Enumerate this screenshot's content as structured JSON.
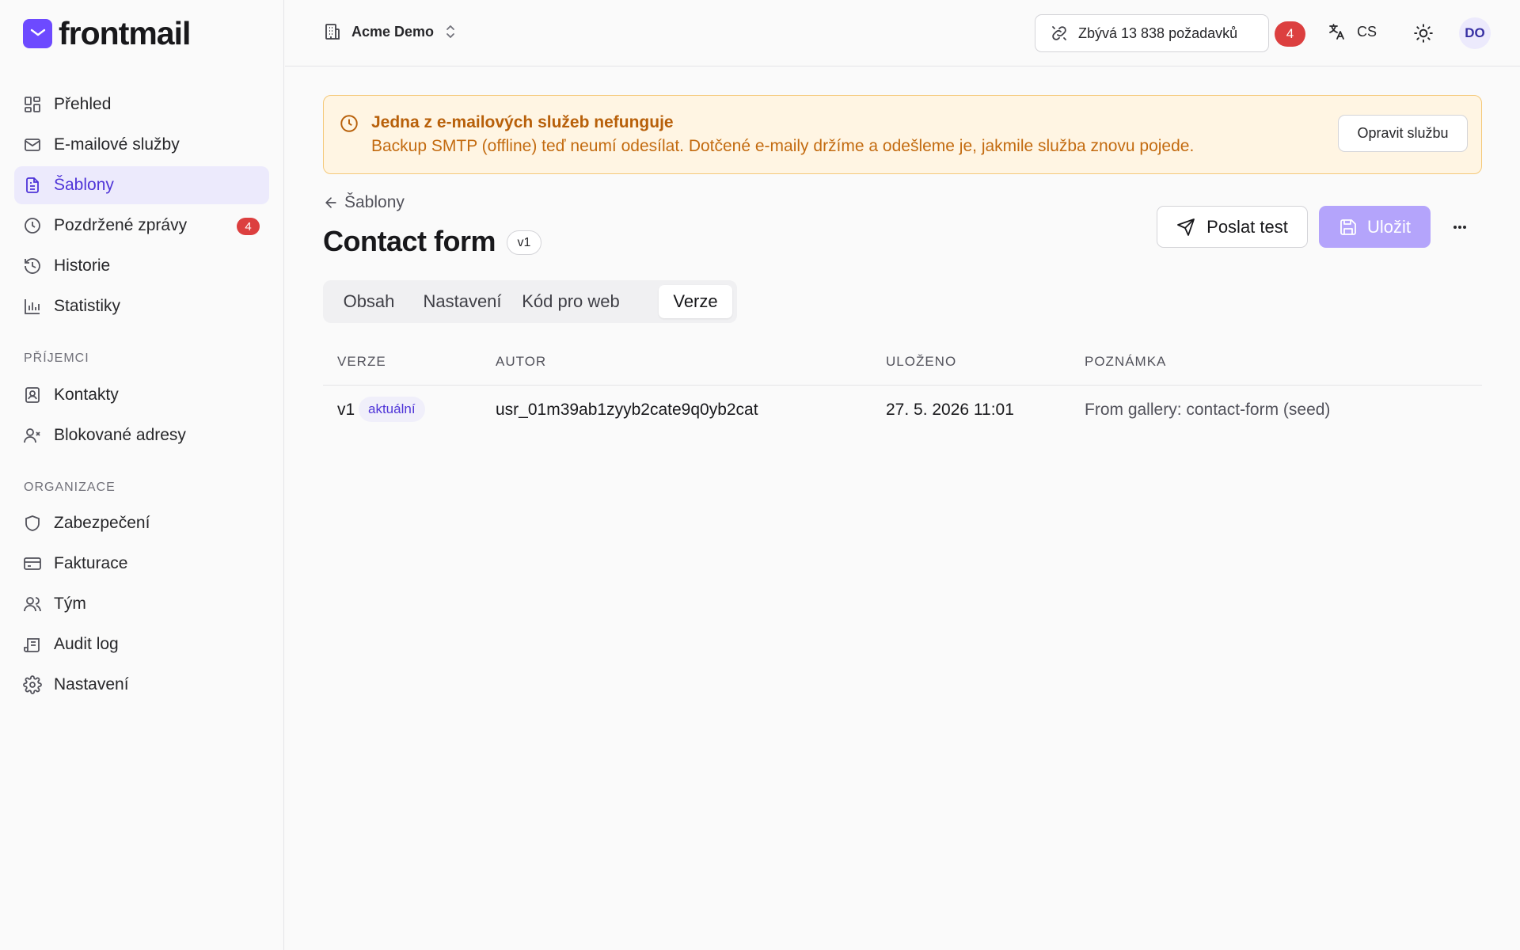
{
  "app": {
    "brand": "frontmail",
    "accent_color": "#6d4aff"
  },
  "sidebar": {
    "main_items": [
      {
        "label": "Přehled",
        "icon": "dashboard-icon"
      },
      {
        "label": "E-mailové služby",
        "icon": "mail-icon"
      },
      {
        "label": "Šablony",
        "icon": "file-text-icon",
        "active": true
      },
      {
        "label": "Pozdržené zprávy",
        "icon": "clock-icon",
        "badge": "4"
      },
      {
        "label": "Historie",
        "icon": "history-icon"
      },
      {
        "label": "Statistiky",
        "icon": "bar-chart-icon"
      }
    ],
    "recipients_section": "PŘÍJEMCI",
    "recipients_items": [
      {
        "label": "Kontakty",
        "icon": "contact-card-icon"
      },
      {
        "label": "Blokované adresy",
        "icon": "user-x-icon"
      }
    ],
    "org_section": "ORGANIZACE",
    "org_items": [
      {
        "label": "Zabezpečení",
        "icon": "shield-icon"
      },
      {
        "label": "Fakturace",
        "icon": "credit-card-icon"
      },
      {
        "label": "Tým",
        "icon": "users-icon"
      },
      {
        "label": "Audit log",
        "icon": "scroll-icon"
      },
      {
        "label": "Nastavení",
        "icon": "gear-icon"
      }
    ]
  },
  "topbar": {
    "org_name": "Acme Demo",
    "quota_text": "Zbývá 13 838 požadavků",
    "notification_count": "4",
    "language": "CS",
    "avatar_initials": "DO"
  },
  "alert": {
    "title": "Jedna z e-mailových služeb nefunguje",
    "message": "Backup SMTP (offline) teď neumí odesílat. Dotčené e-maily držíme a odešleme je, jakmile služba znovu pojede.",
    "action_label": "Opravit službu"
  },
  "page": {
    "back_label": "Šablony",
    "title": "Contact form",
    "version": "v1",
    "send_test_label": "Poslat test",
    "save_label": "Uložit"
  },
  "tabs": [
    {
      "label": "Obsah"
    },
    {
      "label": "Nastavení"
    },
    {
      "label": "Kód pro web"
    },
    {
      "label": "Verze",
      "active": true
    }
  ],
  "versions_table": {
    "columns": [
      "VERZE",
      "AUTOR",
      "ULOŽENO",
      "POZNÁMKA"
    ],
    "rows": [
      {
        "version": "v1",
        "badge": "aktuální",
        "author": "usr_01m39ab1zyyb2cate9q0yb2cat",
        "saved": "27. 5. 2026 11:01",
        "note": "From gallery: contact-form (seed)"
      }
    ]
  }
}
